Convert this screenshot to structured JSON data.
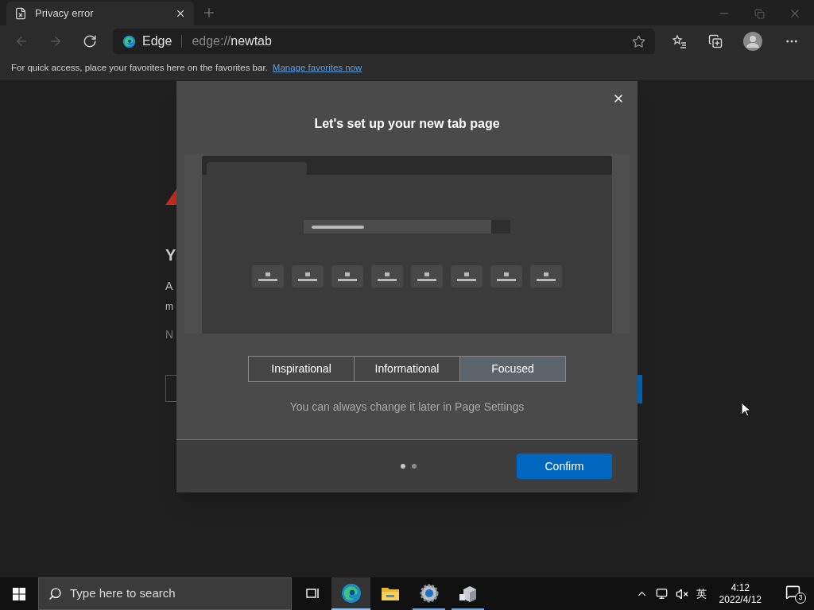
{
  "tab": {
    "title": "Privacy error"
  },
  "address_bar": {
    "site_label": "Edge",
    "scheme": "edge://",
    "path": "newtab"
  },
  "favorites_bar": {
    "message": "For quick access, place your favorites here on the favorites bar.",
    "link": "Manage favorites now"
  },
  "background_page": {
    "heading_fragment": "Y",
    "line_fragments": [
      "A",
      "m"
    ],
    "note_fragment": "N"
  },
  "dialog": {
    "title": "Let's set up your new tab page",
    "options": [
      {
        "label": "Inspirational",
        "selected": false
      },
      {
        "label": "Informational",
        "selected": false
      },
      {
        "label": "Focused",
        "selected": true
      }
    ],
    "hint": "You can always change it later in Page Settings",
    "steps": [
      {
        "selected": true
      },
      {
        "selected": false
      }
    ],
    "confirm": "Confirm"
  },
  "taskbar": {
    "search_placeholder": "Type here to search",
    "apps": [
      {
        "kind": "taskview",
        "running": false,
        "selected": false
      },
      {
        "kind": "edge",
        "running": true,
        "selected": true
      },
      {
        "kind": "folder",
        "running": false,
        "selected": false
      },
      {
        "kind": "settings",
        "running": true,
        "selected": false
      },
      {
        "kind": "device",
        "running": true,
        "selected": false
      }
    ],
    "ime": "英",
    "time": "4:12",
    "date": "2022/4/12",
    "notifications": "3"
  }
}
